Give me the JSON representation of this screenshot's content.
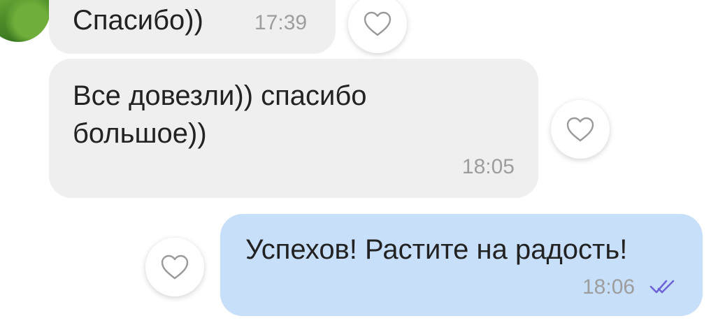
{
  "messages": [
    {
      "direction": "incoming",
      "text": "Спасибо))",
      "time": "17:39"
    },
    {
      "direction": "incoming",
      "text": "Все довезли)) спасибо\nбольшое))",
      "time": "18:05"
    },
    {
      "direction": "outgoing",
      "text": "Успехов! Растите на радость!",
      "time": "18:06",
      "status_icon": "double-check-icon",
      "status_color": "#6e63d6"
    }
  ],
  "colors": {
    "incoming_bubble": "#efefef",
    "outgoing_bubble": "#c8dff9",
    "timestamp": "#9d9d9d",
    "heart_outline": "#9a9a9a"
  },
  "icons": {
    "like": "heart-outline-icon",
    "avatar": "dandelion-avatar"
  }
}
